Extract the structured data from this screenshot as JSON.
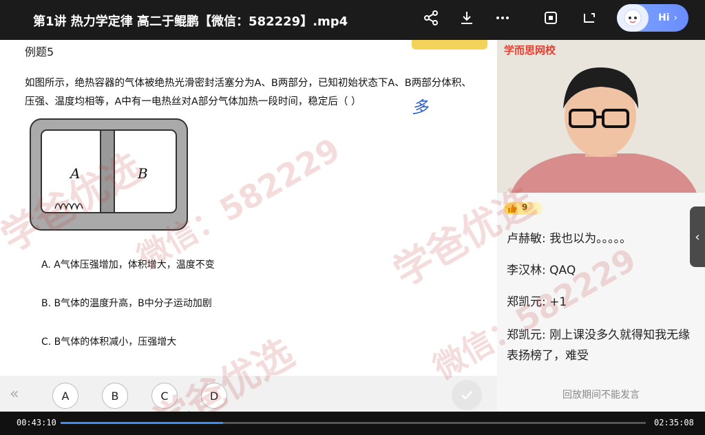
{
  "window": {
    "title": "第1讲 热力学定律 高二于鲲鹏【微信：582229】.mp4"
  },
  "toolbar": {
    "icons": [
      "share-icon",
      "download-icon",
      "more-icon",
      "screenshot-icon",
      "pip-icon"
    ],
    "assistant_label": "Hi"
  },
  "slide": {
    "question_title": "例题5",
    "question_text": "如图所示，绝热容器的气体被绝热光滑密封活塞分为A、B两部分，已知初始状态下A、B两部分体积、压强、温度均相等，A中有一电热丝对A部分气体加热一段时间，稳定后（    ）",
    "handwriting": "多",
    "diagram": {
      "label_a": "A",
      "label_b": "B"
    },
    "options": [
      "A.  A气体压强增加，体积增大，温度不变",
      "B.  B气体的温度升高，B中分子运动加剧",
      "C.  B气体的体积减小，压强增大"
    ],
    "answer_buttons": [
      "A",
      "B",
      "C",
      "D"
    ]
  },
  "video": {
    "brand": "学而思网校"
  },
  "chat": {
    "likes": "9",
    "messages": [
      {
        "user": "卢赫敏",
        "text": "我也以为。。。。。"
      },
      {
        "user": "李汉林",
        "text": "QAQ"
      },
      {
        "user": "郑凯元",
        "text": "+1"
      },
      {
        "user": "郑凯元",
        "text": "刚上课没多久就得知我无缘表扬榜了，难受"
      }
    ],
    "footer": "回放期间不能发言"
  },
  "player": {
    "current_time": "00:43:10",
    "total_time": "02:35:08",
    "progress": 0.278
  },
  "watermark": {
    "text1": "学爸优选",
    "text2": "微信：582229"
  },
  "colors": {
    "accent": "#3a8ef6",
    "brand_red": "#e53e2e"
  }
}
